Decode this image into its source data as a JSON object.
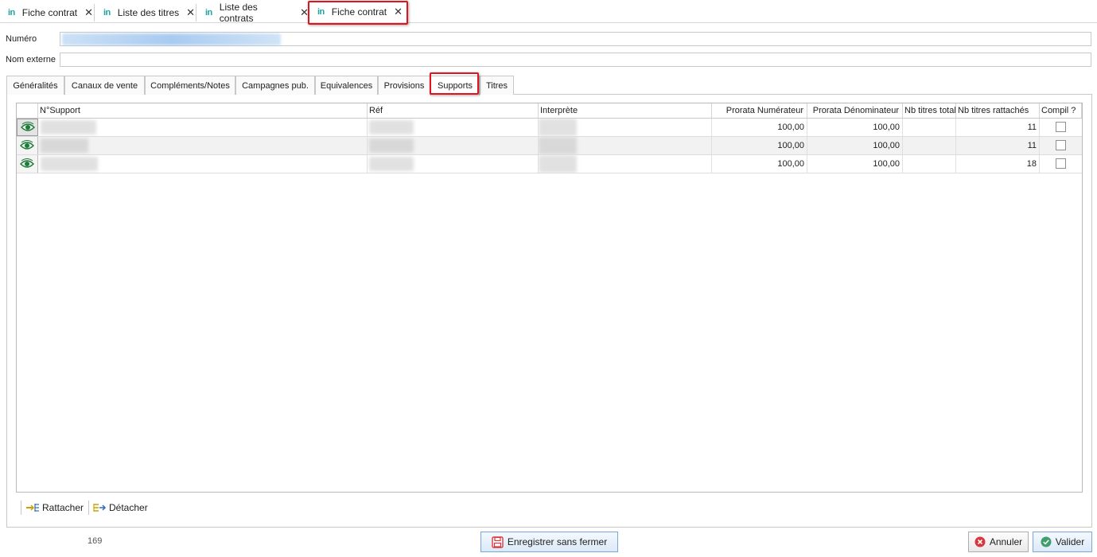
{
  "doc_tabs": [
    {
      "logo": "in",
      "label": "Fiche contrat",
      "close": "✕"
    },
    {
      "logo": "in",
      "label": "Liste des titres",
      "close": "✕"
    },
    {
      "logo": "in",
      "label": "Liste des contrats",
      "close": "✕"
    },
    {
      "logo": "in",
      "label": "Fiche contrat",
      "close": "✕",
      "active": true
    }
  ],
  "form": {
    "numero_label": "Numéro",
    "numero_value": "",
    "nom_externe_label": "Nom externe",
    "nom_externe_value": ""
  },
  "sub_tabs": [
    {
      "label": "Généralités"
    },
    {
      "label": "Canaux de vente"
    },
    {
      "label": "Compléments/Notes"
    },
    {
      "label": "Campagnes pub."
    },
    {
      "label": "Equivalences"
    },
    {
      "label": "Provisions"
    },
    {
      "label": "Supports",
      "active": true
    },
    {
      "label": "Titres"
    }
  ],
  "grid": {
    "columns": [
      "N°Support",
      "Réf",
      "Interprète",
      "Prorata Numérateur",
      "Prorata Dénominateur",
      "Nb titres total",
      "Nb titres rattachés",
      "Compil ?"
    ],
    "rows": [
      {
        "prorata_num": "100,00",
        "prorata_den": "100,00",
        "nb_titres_total": "",
        "nb_titres_rattaches": "11",
        "compil": false
      },
      {
        "prorata_num": "100,00",
        "prorata_den": "100,00",
        "nb_titres_total": "",
        "nb_titres_rattaches": "11",
        "compil": false
      },
      {
        "prorata_num": "100,00",
        "prorata_den": "100,00",
        "nb_titres_total": "",
        "nb_titres_rattaches": "18",
        "compil": false
      }
    ]
  },
  "toolbar": {
    "attach_label": "Rattacher",
    "detach_label": "Détacher"
  },
  "footer": {
    "counter": "169",
    "save_label": "Enregistrer sans fermer",
    "cancel_label": "Annuler",
    "validate_label": "Valider"
  },
  "colors": {
    "highlight": "#e0141e",
    "logo": "#1aa3a3",
    "eye": "#1f7a3a",
    "cancel_icon": "#d9363e",
    "validate_icon": "#3f9e6b"
  }
}
